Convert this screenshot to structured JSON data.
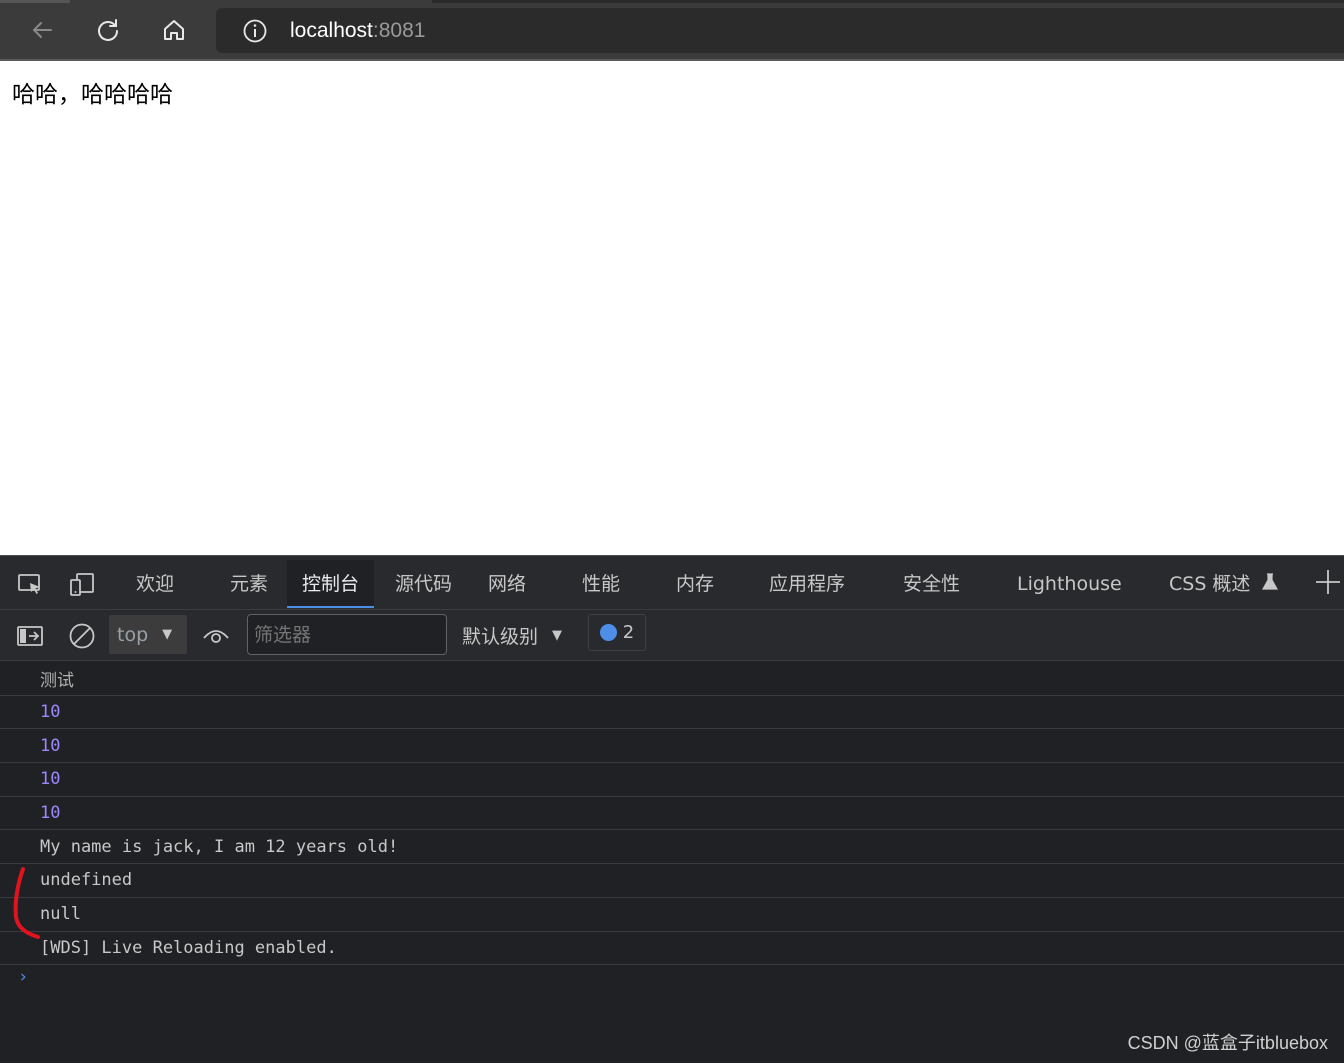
{
  "browser": {
    "address": {
      "host": "localhost",
      "port": ":8081"
    }
  },
  "page": {
    "text": "哈哈，哈哈哈哈"
  },
  "devtools": {
    "tabs": [
      {
        "label": "欢迎"
      },
      {
        "label": "元素"
      },
      {
        "label": "控制台"
      },
      {
        "label": "源代码"
      },
      {
        "label": "网络"
      },
      {
        "label": "性能"
      },
      {
        "label": "内存"
      },
      {
        "label": "应用程序"
      },
      {
        "label": "安全性"
      },
      {
        "label": "Lighthouse"
      },
      {
        "label": "CSS 概述"
      }
    ],
    "active_tab": "控制台",
    "toolbar": {
      "context": "top",
      "filter_placeholder": "筛选器",
      "level": "默认级别",
      "message_count": "2"
    },
    "console": [
      {
        "text": "测试",
        "kind": "cjk"
      },
      {
        "text": "10",
        "kind": "number"
      },
      {
        "text": "10",
        "kind": "number"
      },
      {
        "text": "10",
        "kind": "number"
      },
      {
        "text": "10",
        "kind": "number"
      },
      {
        "text": "My name is jack, I am 12 years old!",
        "kind": "text"
      },
      {
        "text": "undefined",
        "kind": "text"
      },
      {
        "text": "null",
        "kind": "text"
      },
      {
        "text": "[WDS] Live Reloading enabled.",
        "kind": "text"
      }
    ],
    "prompt": "›"
  },
  "watermark": "CSDN @蓝盒子itbluebox",
  "colors": {
    "accent": "#4d8fe8",
    "number": "#9e87ff",
    "annotation": "#e0141e"
  }
}
